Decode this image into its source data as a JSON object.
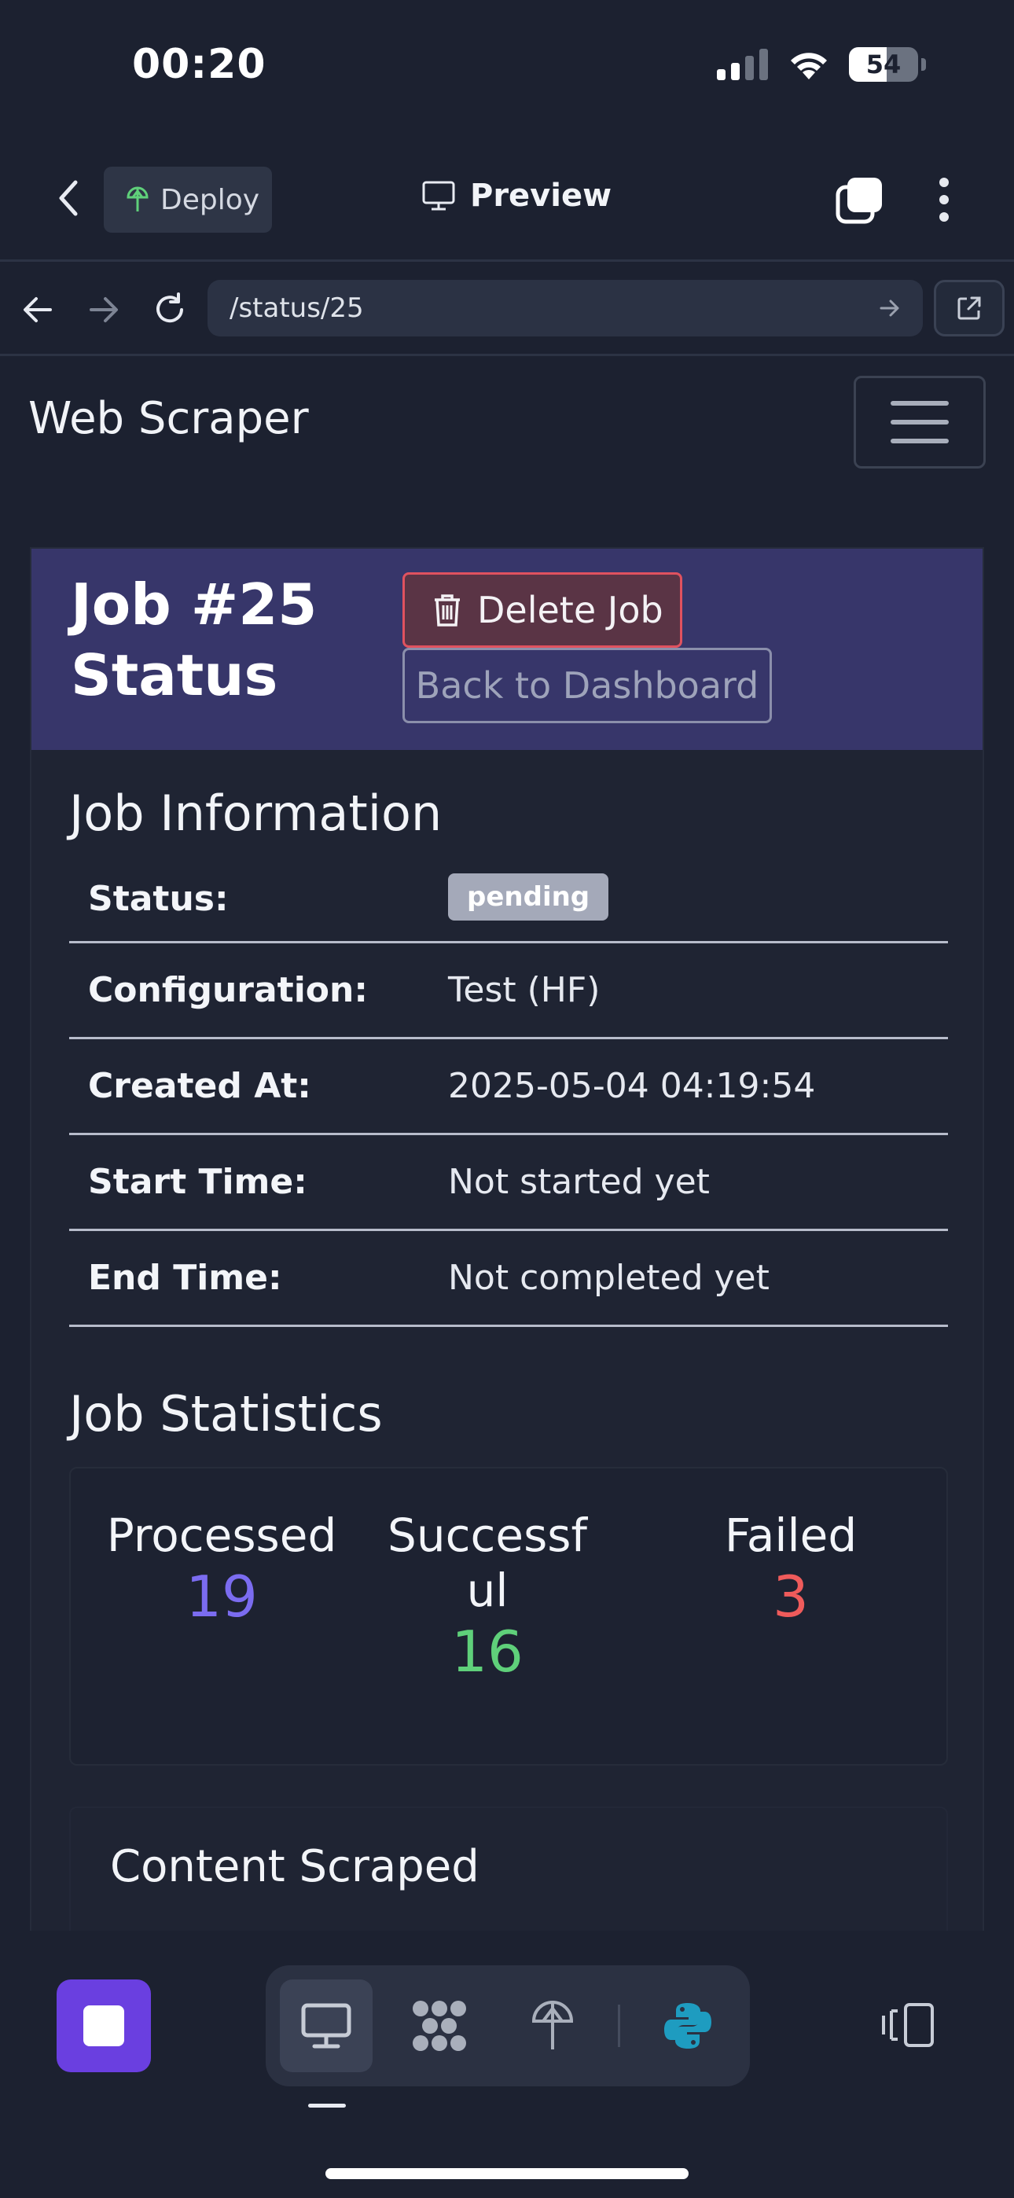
{
  "status_bar": {
    "time": "00:20",
    "battery": "54"
  },
  "app_bar": {
    "deploy_label": "Deploy",
    "preview_label": "Preview"
  },
  "browser": {
    "url": "/status/25"
  },
  "page": {
    "brand": "Web Scraper",
    "job_title_line1": "Job #25",
    "job_title_line2": "Status",
    "delete_button": "Delete Job",
    "back_button": "Back to Dashboard",
    "info_heading": "Job Information",
    "info_rows": [
      {
        "label": "Status:",
        "value": "pending"
      },
      {
        "label": "Configuration:",
        "value": "Test (HF)"
      },
      {
        "label": "Created At:",
        "value": "2025-05-04 04:19:54"
      },
      {
        "label": "Start Time:",
        "value": "Not started yet"
      },
      {
        "label": "End Time:",
        "value": "Not completed yet"
      }
    ],
    "stats_heading": "Job Statistics",
    "stats": [
      {
        "label": "Processed",
        "value": "19",
        "color": "#7b6cf0"
      },
      {
        "label": "Successful",
        "value": "16",
        "color": "#5fd07a"
      },
      {
        "label": "Failed",
        "value": "3",
        "color": "#ef5b5b"
      }
    ],
    "content_heading": "Content Scraped"
  },
  "colors": {
    "background": "#1c2130",
    "header": "#37366a",
    "accent": "#6a3fe0",
    "danger": "#e0525f"
  },
  "icons": [
    "back-chevron-icon",
    "deploy-icon",
    "monitor-icon",
    "tabs-icon",
    "more-icon",
    "arrow-left-icon",
    "arrow-right-icon",
    "reload-icon",
    "external-link-icon",
    "trash-icon",
    "stop-icon",
    "monitor-icon",
    "shapes-icon",
    "deploy-icon",
    "python-icon",
    "panel-icon"
  ]
}
